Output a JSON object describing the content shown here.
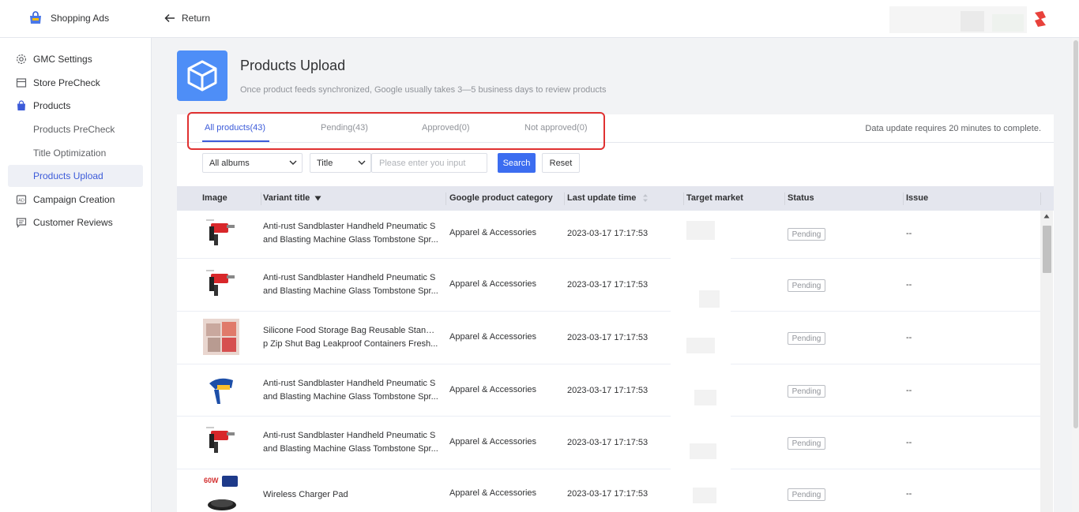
{
  "app": {
    "name": "Shopping Ads",
    "return_label": "Return"
  },
  "sidebar": {
    "items": [
      {
        "label": "GMC Settings",
        "icon": "gear-icon"
      },
      {
        "label": "Store PreCheck",
        "icon": "store-icon"
      },
      {
        "label": "Products",
        "icon": "shopping-bag-icon"
      },
      {
        "label": "Products PreCheck"
      },
      {
        "label": "Title Optimization"
      },
      {
        "label": "Products Upload"
      },
      {
        "label": "Campaign Creation",
        "icon": "ad-icon"
      },
      {
        "label": "Customer Reviews",
        "icon": "review-icon"
      }
    ],
    "active": "Products Upload"
  },
  "page": {
    "title": "Products Upload",
    "subtitle": "Once product feeds synchronized, Google usually takes 3—5 business days to review products",
    "icon": "box-icon"
  },
  "tabs": [
    {
      "label": "All products(43)",
      "active": true
    },
    {
      "label": "Pending(43)",
      "active": false
    },
    {
      "label": "Approved(0)",
      "active": false
    },
    {
      "label": "Not approved(0)",
      "active": false
    }
  ],
  "data_note": "Data update requires 20 minutes to complete.",
  "filters": {
    "album_select": "All albums",
    "field_select": "Title",
    "search_placeholder": "Please enter you input",
    "search_label": "Search",
    "reset_label": "Reset"
  },
  "table": {
    "headers": [
      "Image",
      "Variant title",
      "Google product category",
      "Last update time",
      "Target market",
      "Status",
      "Issue"
    ],
    "rows": [
      {
        "title_l1": "Anti-rust Sandblaster Handheld Pneumatic S",
        "title_l2": "and Blasting Machine Glass Tombstone Spr...",
        "category": "Apparel & Accessories",
        "updated": "2023-03-17 17:17:53",
        "status": "Pending",
        "issue": "--",
        "thumb": "sandblaster-red"
      },
      {
        "title_l1": "Anti-rust Sandblaster Handheld Pneumatic S",
        "title_l2": "and Blasting Machine Glass Tombstone Spr...",
        "category": "Apparel & Accessories",
        "updated": "2023-03-17 17:17:53",
        "status": "Pending",
        "issue": "--",
        "thumb": "sandblaster-red"
      },
      {
        "title_l1": "Silicone Food Storage Bag Reusable Stand U",
        "title_l2": "p Zip Shut Bag Leakproof Containers Fresh...",
        "category": "Apparel & Accessories",
        "updated": "2023-03-17 17:17:53",
        "status": "Pending",
        "issue": "--",
        "thumb": "food-bags"
      },
      {
        "title_l1": "Anti-rust Sandblaster Handheld Pneumatic S",
        "title_l2": "and Blasting Machine Glass Tombstone Spr...",
        "category": "Apparel & Accessories",
        "updated": "2023-03-17 17:17:53",
        "status": "Pending",
        "issue": "--",
        "thumb": "sandblaster-blue"
      },
      {
        "title_l1": "Anti-rust Sandblaster Handheld Pneumatic S",
        "title_l2": "and Blasting Machine Glass Tombstone Spr...",
        "category": "Apparel & Accessories",
        "updated": "2023-03-17 17:17:53",
        "status": "Pending",
        "issue": "--",
        "thumb": "sandblaster-red"
      },
      {
        "title_l1": "Wireless Charger Pad",
        "title_l2": "",
        "category": "Apparel & Accessories",
        "updated": "2023-03-17 17:17:53",
        "status": "Pending",
        "issue": "--",
        "thumb": "wireless-charger",
        "thumb_text": "60W"
      }
    ]
  },
  "colors": {
    "accent": "#3c5bd9",
    "button": "#3c6df0",
    "highlight": "#e03131",
    "product_icon_bg": "#4e8ef7"
  }
}
